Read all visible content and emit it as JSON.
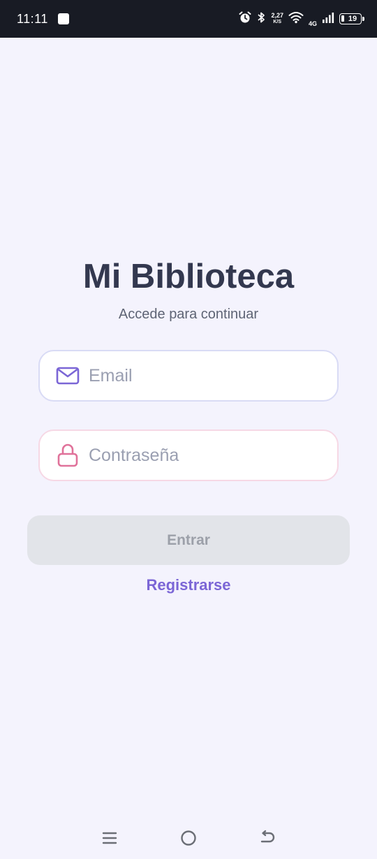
{
  "status_bar": {
    "time": "11:11",
    "net_speed_value": "2,27",
    "net_speed_unit": "K/S",
    "network_type": "4G",
    "battery_level": "19",
    "icons": [
      "notification-square-icon",
      "alarm-icon",
      "bluetooth-icon",
      "wifi-icon",
      "signal-icon",
      "battery-icon"
    ]
  },
  "login": {
    "title": "Mi Biblioteca",
    "subtitle": "Accede para continuar",
    "email_placeholder": "Email",
    "email_value": "",
    "password_placeholder": "Contraseña",
    "password_value": "",
    "submit_label": "Entrar",
    "register_label": "Registrarse"
  },
  "nav_bar": {
    "icons": [
      "menu-icon",
      "home-icon",
      "back-icon"
    ]
  },
  "colors": {
    "background": "#f4f3fd",
    "title": "#33384f",
    "accent": "#7b66d6",
    "email_icon": "#7b66d6",
    "lock_icon": "#e0729a",
    "button_disabled": "#e2e4e9"
  }
}
